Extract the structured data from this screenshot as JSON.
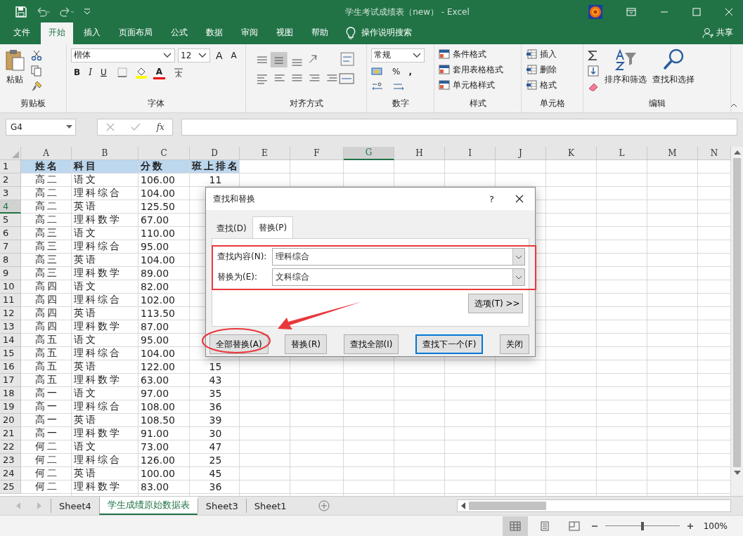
{
  "window": {
    "title": "学生考试成绩表（new）  -  Excel"
  },
  "ribbon_tabs": [
    {
      "label": "文件",
      "selected": false
    },
    {
      "label": "开始",
      "selected": true
    },
    {
      "label": "插入",
      "selected": false
    },
    {
      "label": "页面布局",
      "selected": false
    },
    {
      "label": "公式",
      "selected": false
    },
    {
      "label": "数据",
      "selected": false
    },
    {
      "label": "审阅",
      "selected": false
    },
    {
      "label": "视图",
      "selected": false
    },
    {
      "label": "帮助",
      "selected": false
    }
  ],
  "tell_me": "操作说明搜索",
  "share": "共享",
  "ribbon": {
    "clipboard": {
      "label": "剪贴板",
      "paste": "粘贴"
    },
    "font": {
      "label": "字体",
      "font_name": "楷体",
      "font_size": "12",
      "grow": "A",
      "shrink": "A",
      "bold": "B",
      "italic": "I",
      "underline": "U",
      "font_color": "A"
    },
    "alignment": {
      "label": "对齐方式"
    },
    "number": {
      "label": "数字",
      "format": "常规",
      "percent": "%",
      "comma": ","
    },
    "styles": {
      "label": "样式",
      "items": [
        "条件格式",
        "套用表格格式",
        "单元格样式"
      ]
    },
    "cells": {
      "label": "单元格",
      "items": [
        "插入",
        "删除",
        "格式"
      ]
    },
    "editing": {
      "label": "编辑",
      "sort": "排序和筛选",
      "find": "查找和选择"
    }
  },
  "formula_bar": {
    "name_box": "G4",
    "fx": "fx"
  },
  "columns": [
    {
      "label": "A",
      "selected": false
    },
    {
      "label": "B",
      "selected": false
    },
    {
      "label": "C",
      "selected": false
    },
    {
      "label": "D",
      "selected": false
    },
    {
      "label": "E",
      "selected": false
    },
    {
      "label": "F",
      "selected": false
    },
    {
      "label": "G",
      "selected": true
    },
    {
      "label": "H",
      "selected": false
    },
    {
      "label": "I",
      "selected": false
    },
    {
      "label": "J",
      "selected": false
    },
    {
      "label": "K",
      "selected": false
    },
    {
      "label": "L",
      "selected": false
    },
    {
      "label": "M",
      "selected": false
    },
    {
      "label": "N",
      "selected": false
    }
  ],
  "rows": [
    {
      "num": "1",
      "selected": false,
      "header": true,
      "cells": [
        "姓名",
        "科目",
        "分数",
        "班上排名"
      ]
    },
    {
      "num": "2",
      "selected": false,
      "cells": [
        "高二",
        "语文",
        "106.00",
        "11"
      ]
    },
    {
      "num": "3",
      "selected": false,
      "cells": [
        "高二",
        "理科综合",
        "104.00"
      ]
    },
    {
      "num": "4",
      "selected": true,
      "cells": [
        "高二",
        "英语",
        "125.50"
      ]
    },
    {
      "num": "5",
      "selected": false,
      "cells": [
        "高二",
        "理科数学",
        "67.00"
      ]
    },
    {
      "num": "6",
      "selected": false,
      "cells": [
        "高三",
        "语文",
        "110.00"
      ]
    },
    {
      "num": "7",
      "selected": false,
      "cells": [
        "高三",
        "理科综合",
        "95.00"
      ]
    },
    {
      "num": "8",
      "selected": false,
      "cells": [
        "高三",
        "英语",
        "104.00"
      ]
    },
    {
      "num": "9",
      "selected": false,
      "cells": [
        "高三",
        "理科数学",
        "89.00"
      ]
    },
    {
      "num": "10",
      "selected": false,
      "cells": [
        "高四",
        "语文",
        "82.00"
      ]
    },
    {
      "num": "11",
      "selected": false,
      "cells": [
        "高四",
        "理科综合",
        "102.00"
      ]
    },
    {
      "num": "12",
      "selected": false,
      "cells": [
        "高四",
        "英语",
        "113.50"
      ]
    },
    {
      "num": "13",
      "selected": false,
      "cells": [
        "高四",
        "理科数学",
        "87.00"
      ]
    },
    {
      "num": "14",
      "selected": false,
      "cells": [
        "高五",
        "语文",
        "95.00"
      ]
    },
    {
      "num": "15",
      "selected": false,
      "cells": [
        "高五",
        "理科综合",
        "104.00"
      ]
    },
    {
      "num": "16",
      "selected": false,
      "cells": [
        "高五",
        "英语",
        "122.00",
        "15"
      ]
    },
    {
      "num": "17",
      "selected": false,
      "cells": [
        "高五",
        "理科数学",
        "63.00",
        "43"
      ]
    },
    {
      "num": "18",
      "selected": false,
      "cells": [
        "高一",
        "语文",
        "97.00",
        "35"
      ]
    },
    {
      "num": "19",
      "selected": false,
      "cells": [
        "高一",
        "理科综合",
        "108.00",
        "36"
      ]
    },
    {
      "num": "20",
      "selected": false,
      "cells": [
        "高一",
        "英语",
        "108.50",
        "39"
      ]
    },
    {
      "num": "21",
      "selected": false,
      "cells": [
        "高一",
        "理科数学",
        "91.00",
        "30"
      ]
    },
    {
      "num": "22",
      "selected": false,
      "cells": [
        "何二",
        "语文",
        "73.00",
        "47"
      ]
    },
    {
      "num": "23",
      "selected": false,
      "cells": [
        "何二",
        "理科综合",
        "126.00",
        "25"
      ]
    },
    {
      "num": "24",
      "selected": false,
      "cells": [
        "何二",
        "英语",
        "100.00",
        "45"
      ]
    },
    {
      "num": "25",
      "selected": false,
      "cells": [
        "何二",
        "理科数学",
        "83.00",
        "36"
      ]
    }
  ],
  "dialog": {
    "title": "查找和替换",
    "help": "?",
    "tabs": [
      {
        "label": "查找(D)",
        "selected": false
      },
      {
        "label": "替换(P)",
        "selected": true
      }
    ],
    "fields": [
      {
        "label": "查找内容(N):",
        "value": "理科综合"
      },
      {
        "label": "替换为(E):",
        "value": "文科综合"
      }
    ],
    "options": "选项(T) >>",
    "buttons": [
      {
        "label": "全部替换(A)",
        "default": false
      },
      {
        "label": "替换(R)",
        "default": false
      },
      {
        "label": "查找全部(I)",
        "default": false
      },
      {
        "label": "查找下一个(F)",
        "default": true
      },
      {
        "label": "关闭",
        "default": false
      }
    ]
  },
  "sheet_tabs": [
    {
      "label": "Sheet4",
      "selected": false
    },
    {
      "label": "学生成绩原始数据表",
      "selected": true
    },
    {
      "label": "Sheet3",
      "selected": false
    },
    {
      "label": "Sheet1",
      "selected": false
    }
  ],
  "status_bar": {
    "views": [
      {
        "kind": "normal",
        "selected": true
      },
      {
        "kind": "page-layout",
        "selected": false
      },
      {
        "kind": "page-break",
        "selected": false
      }
    ],
    "zoom": "100%",
    "zoom_slider": {
      "level": 0.5
    }
  }
}
